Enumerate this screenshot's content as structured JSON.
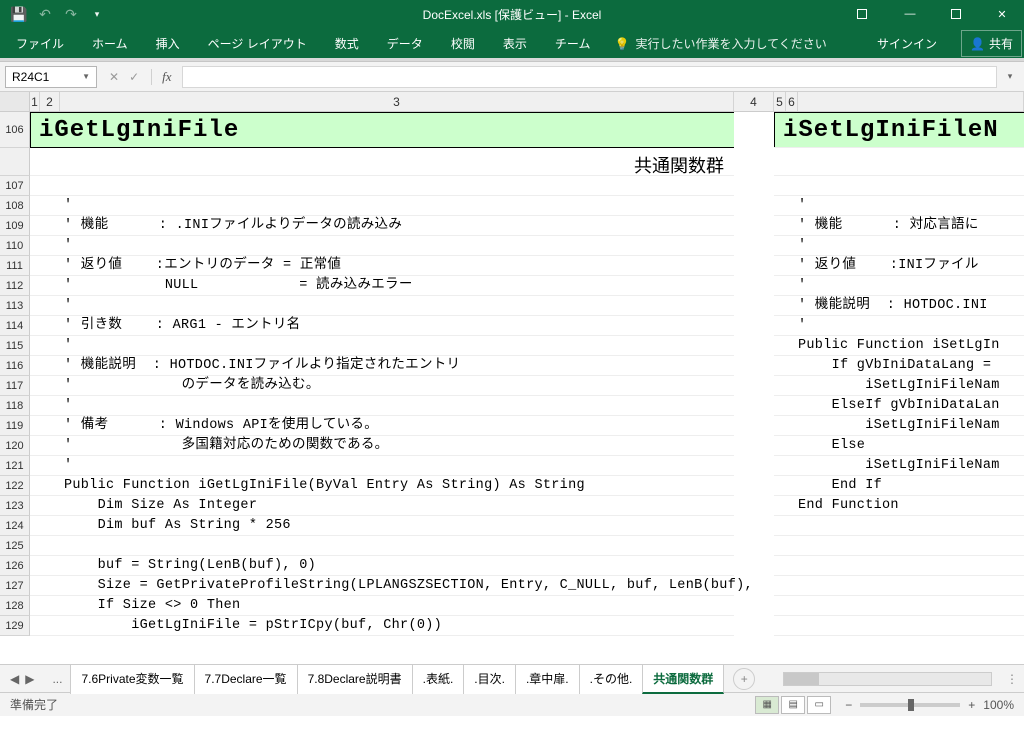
{
  "title": "DocExcel.xls [保護ビュー] - Excel",
  "qat": {
    "save": "💾",
    "undo": "↶",
    "redo": "↷",
    "dd": "▾"
  },
  "winctl": {
    "min": "—",
    "close": "✕"
  },
  "ribbon": {
    "tabs": [
      "ファイル",
      "ホーム",
      "挿入",
      "ページ レイアウト",
      "数式",
      "データ",
      "校閲",
      "表示",
      "チーム"
    ],
    "tell_icon": "💡",
    "tell": "実行したい作業を入力してください",
    "signin": "サインイン",
    "share_icon": "👤",
    "share": "共有"
  },
  "namebox": "R24C1",
  "fx": {
    "cancel": "✕",
    "confirm": "✓",
    "label": "fx",
    "expand": "▾"
  },
  "cols_vis": {
    "c1w": 10,
    "c2w": 20,
    "c3w": 670,
    "gapw": 44,
    "c4w": 10,
    "c5w": 10,
    "c6w": 10,
    "c6restw": 230
  },
  "col_labels": {
    "c1": "1",
    "c2": "2",
    "c3": "3",
    "c4": "4",
    "c5": "5",
    "c6": "6"
  },
  "row_start": 106,
  "left_title": "iGetLgIniFile",
  "right_title": "iSetLgIniFileN",
  "subtitle": "共通関数群",
  "left_code": [
    "",
    "'",
    "' 機能      : .INIファイルよりデータの読み込み",
    "'",
    "' 返り値    :エントリのデータ = 正常値",
    "'           NULL            = 読み込みエラー",
    "'",
    "' 引き数    : ARG1 - エントリ名",
    "'",
    "' 機能説明  : HOTDOC.INIファイルより指定されたエントリ",
    "'             のデータを読み込む。",
    "'",
    "' 備考      : Windows APIを使用している。",
    "'             多国籍対応のための関数である。",
    "'",
    "Public Function iGetLgIniFile(ByVal Entry As String) As String",
    "    Dim Size As Integer",
    "    Dim buf As String * 256",
    "",
    "    buf = String(LenB(buf), 0)",
    "    Size = GetPrivateProfileString(LPLANGSZSECTION, Entry, C_NULL, buf, LenB(buf),",
    "    If Size <> 0 Then",
    "        iGetLgIniFile = pStrICpy(buf, Chr(0))"
  ],
  "right_code": [
    "",
    "'",
    "' 機能      : 対応言語に",
    "'",
    "' 返り値    :INIファイル",
    "'",
    "' 機能説明  : HOTDOC.INI",
    "'",
    "Public Function iSetLgIn",
    "    If gVbIniDataLang =",
    "        iSetLgIniFileNam",
    "    ElseIf gVbIniDataLan",
    "        iSetLgIniFileNam",
    "    Else",
    "        iSetLgIniFileNam",
    "    End If",
    "End Function",
    "",
    "",
    "",
    "",
    "",
    ""
  ],
  "sheet_tabs": [
    "7.6Private変数一覧",
    "7.7Declare一覧",
    "7.8Declare説明書",
    ".表紙.",
    ".目次.",
    ".章中扉.",
    ".その他.",
    "共通関数群"
  ],
  "active_tab": 7,
  "nav": {
    "first": "◀",
    "prev": "",
    "dots": "..."
  },
  "add": "+",
  "status": "準備完了",
  "zoom": "100%",
  "zoom_minus": "−",
  "zoom_plus": "+"
}
